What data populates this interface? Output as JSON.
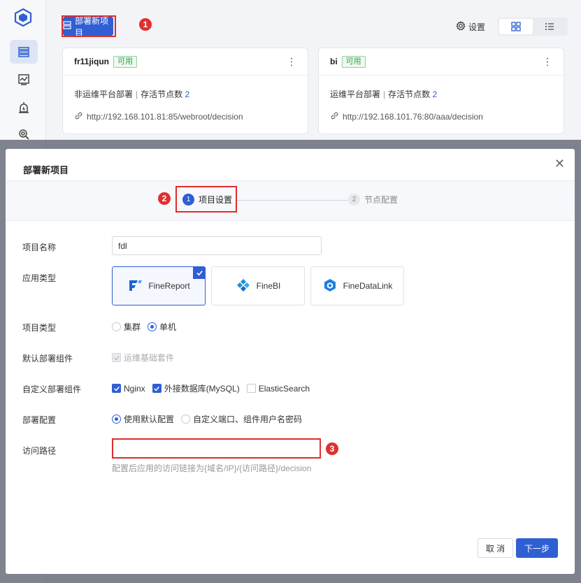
{
  "header": {
    "deploy_button_label": "部署新项目",
    "settings_label": "设置"
  },
  "markers": [
    "1",
    "2",
    "3"
  ],
  "projects": [
    {
      "name": "fr11jiqun",
      "status": "可用",
      "deploy_type": "非运维平台部署",
      "nodes_label": "存活节点数",
      "nodes_count": "2",
      "url": "http://192.168.101.81:85/webroot/decision"
    },
    {
      "name": "bi",
      "status": "可用",
      "deploy_type": "运维平台部署",
      "nodes_label": "存活节点数",
      "nodes_count": "2",
      "url": "http://192.168.101.76:80/aaa/decision"
    }
  ],
  "dialog": {
    "title": "部署新项目",
    "steps": [
      {
        "number": "1",
        "label": "项目设置"
      },
      {
        "number": "2",
        "label": "节点配置"
      }
    ],
    "fields": {
      "project_name_label": "项目名称",
      "project_name_value": "fdl",
      "app_type_label": "应用类型",
      "project_type_label": "项目类型",
      "default_components_label": "默认部署组件",
      "custom_components_label": "自定义部署组件",
      "deploy_config_label": "部署配置",
      "access_path_label": "访问路径"
    },
    "app_types": [
      "FineReport",
      "FineBI",
      "FineDataLink"
    ],
    "selected_app_type": "FineReport",
    "project_types": [
      "集群",
      "单机"
    ],
    "selected_project_type": "单机",
    "default_component": "运维基础套件",
    "custom_components": [
      {
        "label": "Nginx",
        "checked": true
      },
      {
        "label": "外接数据库(MySQL)",
        "checked": true
      },
      {
        "label": "ElasticSearch",
        "checked": false
      }
    ],
    "deploy_configs": [
      "使用默认配置",
      "自定义端口、组件用户名密码"
    ],
    "selected_deploy_config": "使用默认配置",
    "access_path_value": "",
    "access_path_hint": "配置后应用的访问链接为{域名/IP}/{访问路径}/decision",
    "cancel_label": "取 消",
    "next_label": "下一步"
  },
  "colors": {
    "primary": "#2f5fd3",
    "annotation_red": "#e02c2c",
    "status_green": "#2ea043"
  }
}
